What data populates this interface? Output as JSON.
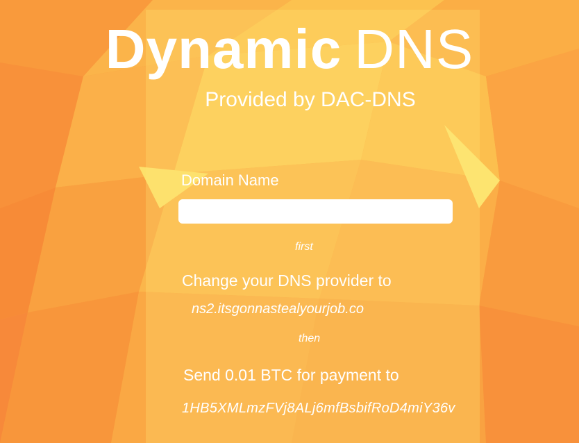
{
  "header": {
    "title_bold": "Dynamic",
    "title_light": "DNS",
    "subtitle": "Provided by DAC-DNS"
  },
  "form": {
    "domain_label": "Domain Name",
    "domain_value": "",
    "domain_placeholder": ""
  },
  "steps": {
    "first_label": "first",
    "step1_text": "Change your DNS provider to",
    "nameserver": "ns2.itsgonnastealyourjob.co",
    "then_label": "then",
    "step2_text": "Send 0.01 BTC for payment to",
    "btc_address": "1HB5XMLmzFVj8ALj6mfBsbifRoD4miY36v"
  },
  "colors": {
    "background": "#f8a13d",
    "text": "#ffffff",
    "input_bg": "#ffffff"
  }
}
